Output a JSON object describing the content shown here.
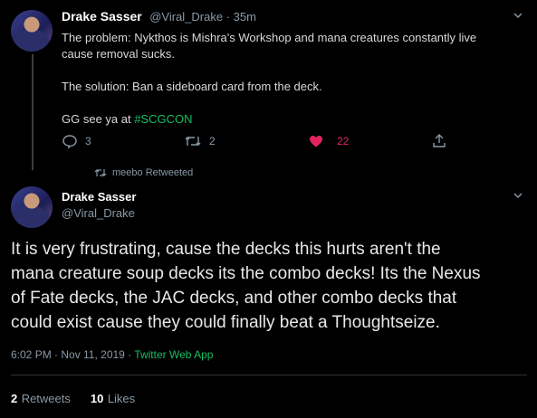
{
  "tweet1": {
    "name": "Drake Sasser",
    "handle_time": "@Viral_Drake · 35m",
    "line1": "The problem: Nykthos is Mishra's Workshop and mana creatures constantly live",
    "line2": "cause removal sucks.",
    "line3": "The solution: Ban a sideboard card from the deck.",
    "gg_text": "GG see ya at ",
    "hashtag": "#SCGCON",
    "replies": "3",
    "retweets": "2",
    "likes": "22"
  },
  "retweeted_by": "meebo Retweeted",
  "tweet2": {
    "name": "Drake Sasser",
    "handle": "@Viral_Drake",
    "text_lines": [
      "It is very frustrating, cause the decks this hurts aren't the",
      "mana creature soup decks its the combo decks! Its the Nexus",
      "of Fate decks, the JAC decks, and other combo decks that",
      "could exist cause they could finally beat a Thoughtseize."
    ],
    "timestamp": "6:02 PM · Nov 11, 2019 · ",
    "source": "Twitter Web App",
    "retweets_count": "2",
    "retweets_label": "Retweets",
    "likes_count": "10",
    "likes_label": "Likes"
  },
  "colors": {
    "background": "#000000",
    "accent_green": "#17bf63",
    "like_red": "#e0245e",
    "muted": "#8899a6"
  }
}
